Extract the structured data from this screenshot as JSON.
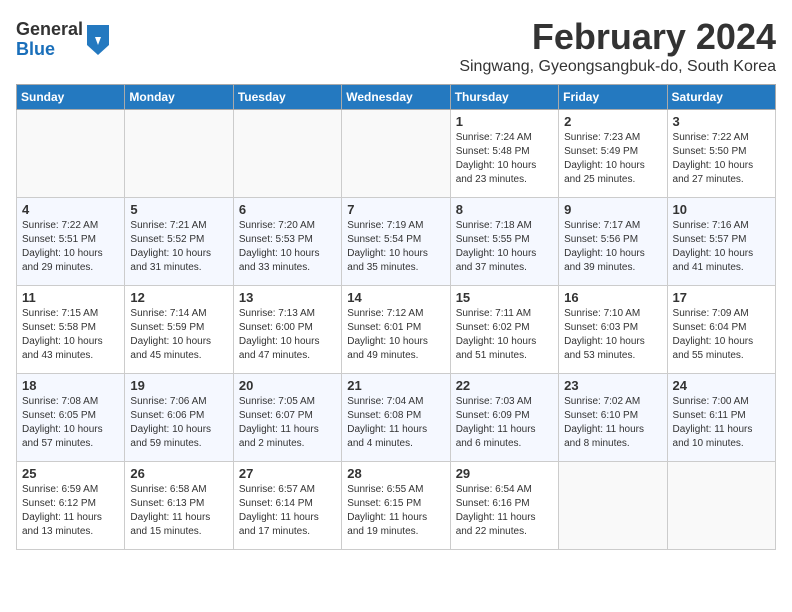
{
  "header": {
    "logo_general": "General",
    "logo_blue": "Blue",
    "month_title": "February 2024",
    "location": "Singwang, Gyeongsangbuk-do, South Korea"
  },
  "days_of_week": [
    "Sunday",
    "Monday",
    "Tuesday",
    "Wednesday",
    "Thursday",
    "Friday",
    "Saturday"
  ],
  "weeks": [
    [
      {
        "day": "",
        "info": ""
      },
      {
        "day": "",
        "info": ""
      },
      {
        "day": "",
        "info": ""
      },
      {
        "day": "",
        "info": ""
      },
      {
        "day": "1",
        "info": "Sunrise: 7:24 AM\nSunset: 5:48 PM\nDaylight: 10 hours\nand 23 minutes."
      },
      {
        "day": "2",
        "info": "Sunrise: 7:23 AM\nSunset: 5:49 PM\nDaylight: 10 hours\nand 25 minutes."
      },
      {
        "day": "3",
        "info": "Sunrise: 7:22 AM\nSunset: 5:50 PM\nDaylight: 10 hours\nand 27 minutes."
      }
    ],
    [
      {
        "day": "4",
        "info": "Sunrise: 7:22 AM\nSunset: 5:51 PM\nDaylight: 10 hours\nand 29 minutes."
      },
      {
        "day": "5",
        "info": "Sunrise: 7:21 AM\nSunset: 5:52 PM\nDaylight: 10 hours\nand 31 minutes."
      },
      {
        "day": "6",
        "info": "Sunrise: 7:20 AM\nSunset: 5:53 PM\nDaylight: 10 hours\nand 33 minutes."
      },
      {
        "day": "7",
        "info": "Sunrise: 7:19 AM\nSunset: 5:54 PM\nDaylight: 10 hours\nand 35 minutes."
      },
      {
        "day": "8",
        "info": "Sunrise: 7:18 AM\nSunset: 5:55 PM\nDaylight: 10 hours\nand 37 minutes."
      },
      {
        "day": "9",
        "info": "Sunrise: 7:17 AM\nSunset: 5:56 PM\nDaylight: 10 hours\nand 39 minutes."
      },
      {
        "day": "10",
        "info": "Sunrise: 7:16 AM\nSunset: 5:57 PM\nDaylight: 10 hours\nand 41 minutes."
      }
    ],
    [
      {
        "day": "11",
        "info": "Sunrise: 7:15 AM\nSunset: 5:58 PM\nDaylight: 10 hours\nand 43 minutes."
      },
      {
        "day": "12",
        "info": "Sunrise: 7:14 AM\nSunset: 5:59 PM\nDaylight: 10 hours\nand 45 minutes."
      },
      {
        "day": "13",
        "info": "Sunrise: 7:13 AM\nSunset: 6:00 PM\nDaylight: 10 hours\nand 47 minutes."
      },
      {
        "day": "14",
        "info": "Sunrise: 7:12 AM\nSunset: 6:01 PM\nDaylight: 10 hours\nand 49 minutes."
      },
      {
        "day": "15",
        "info": "Sunrise: 7:11 AM\nSunset: 6:02 PM\nDaylight: 10 hours\nand 51 minutes."
      },
      {
        "day": "16",
        "info": "Sunrise: 7:10 AM\nSunset: 6:03 PM\nDaylight: 10 hours\nand 53 minutes."
      },
      {
        "day": "17",
        "info": "Sunrise: 7:09 AM\nSunset: 6:04 PM\nDaylight: 10 hours\nand 55 minutes."
      }
    ],
    [
      {
        "day": "18",
        "info": "Sunrise: 7:08 AM\nSunset: 6:05 PM\nDaylight: 10 hours\nand 57 minutes."
      },
      {
        "day": "19",
        "info": "Sunrise: 7:06 AM\nSunset: 6:06 PM\nDaylight: 10 hours\nand 59 minutes."
      },
      {
        "day": "20",
        "info": "Sunrise: 7:05 AM\nSunset: 6:07 PM\nDaylight: 11 hours\nand 2 minutes."
      },
      {
        "day": "21",
        "info": "Sunrise: 7:04 AM\nSunset: 6:08 PM\nDaylight: 11 hours\nand 4 minutes."
      },
      {
        "day": "22",
        "info": "Sunrise: 7:03 AM\nSunset: 6:09 PM\nDaylight: 11 hours\nand 6 minutes."
      },
      {
        "day": "23",
        "info": "Sunrise: 7:02 AM\nSunset: 6:10 PM\nDaylight: 11 hours\nand 8 minutes."
      },
      {
        "day": "24",
        "info": "Sunrise: 7:00 AM\nSunset: 6:11 PM\nDaylight: 11 hours\nand 10 minutes."
      }
    ],
    [
      {
        "day": "25",
        "info": "Sunrise: 6:59 AM\nSunset: 6:12 PM\nDaylight: 11 hours\nand 13 minutes."
      },
      {
        "day": "26",
        "info": "Sunrise: 6:58 AM\nSunset: 6:13 PM\nDaylight: 11 hours\nand 15 minutes."
      },
      {
        "day": "27",
        "info": "Sunrise: 6:57 AM\nSunset: 6:14 PM\nDaylight: 11 hours\nand 17 minutes."
      },
      {
        "day": "28",
        "info": "Sunrise: 6:55 AM\nSunset: 6:15 PM\nDaylight: 11 hours\nand 19 minutes."
      },
      {
        "day": "29",
        "info": "Sunrise: 6:54 AM\nSunset: 6:16 PM\nDaylight: 11 hours\nand 22 minutes."
      },
      {
        "day": "",
        "info": ""
      },
      {
        "day": "",
        "info": ""
      }
    ]
  ]
}
